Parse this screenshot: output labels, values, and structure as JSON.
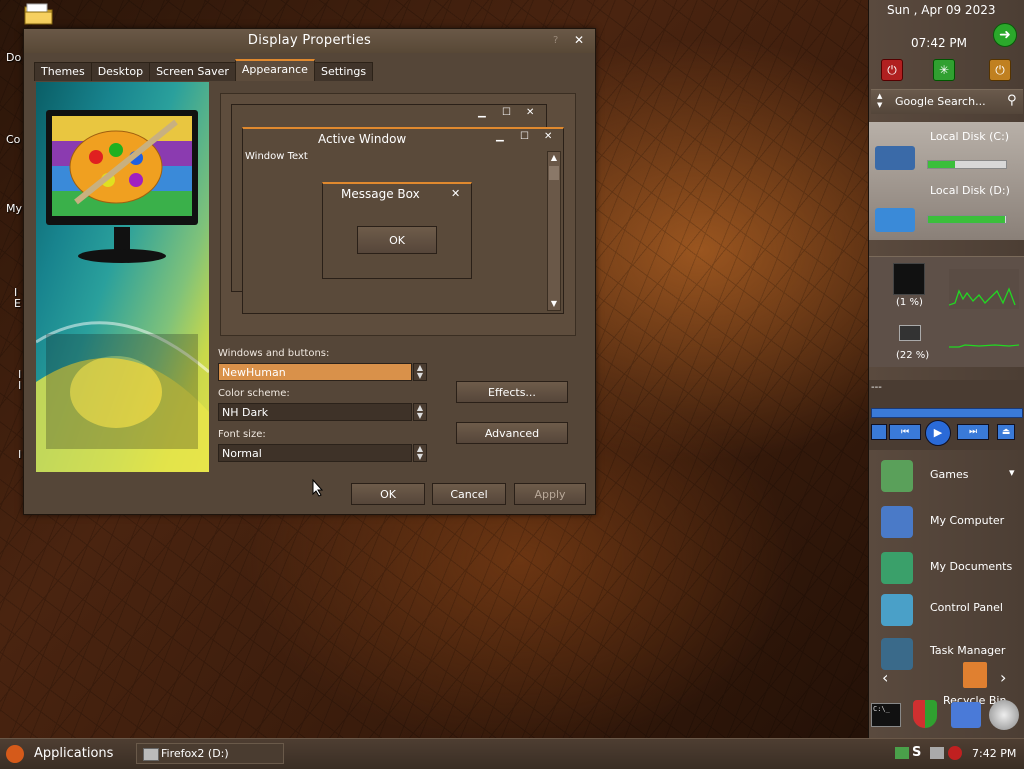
{
  "desktop": {
    "icon_labels": [
      "Do",
      "Co",
      "My",
      "I",
      "E",
      "I",
      "I",
      "I"
    ]
  },
  "dialog": {
    "title": "Display Properties",
    "help_label": "?",
    "close_label": "✕",
    "tabs": [
      {
        "label": "Themes"
      },
      {
        "label": "Desktop"
      },
      {
        "label": "Screen Saver"
      },
      {
        "label": "Appearance"
      },
      {
        "label": "Settings"
      }
    ],
    "active_tab": "Appearance",
    "preview": {
      "inactive_window_controls": [
        "▁",
        "☐",
        "✕"
      ],
      "active_window_title": "Active Window",
      "window_text": "Window Text",
      "message_box_title": "Message Box",
      "message_box_ok": "OK"
    },
    "windows_and_buttons": {
      "label": "Windows and buttons:",
      "value": "NewHuman"
    },
    "color_scheme": {
      "label": "Color scheme:",
      "value": "NH Dark"
    },
    "font_size": {
      "label": "Font size:",
      "value": "Normal"
    },
    "effects_label": "Effects...",
    "advanced_label": "Advanced",
    "ok_label": "OK",
    "cancel_label": "Cancel",
    "apply_label": "Apply"
  },
  "sidebar": {
    "date": "Sun , Apr 09 2023",
    "time": "07:42 PM",
    "search_placeholder": "Google Search...",
    "disk_c": {
      "label": "Local Disk (C:)",
      "used_fraction": 0.35
    },
    "disk_d": {
      "label": "Local Disk (D:)",
      "used_fraction": 0.99
    },
    "cpu_percent": "(1 %)",
    "mem_percent": "(22 %)",
    "media_title": "---",
    "menu": [
      {
        "label": "Games"
      },
      {
        "label": "My Computer"
      },
      {
        "label": "My Documents"
      },
      {
        "label": "Control Panel"
      },
      {
        "label": "Task Manager"
      },
      {
        "label": "Recycle Bin"
      }
    ],
    "prev_arrow": "‹",
    "next_arrow": "›",
    "games_arrow": "▾"
  },
  "taskbar": {
    "applications_label": "Applications",
    "task_label": "Firefox2 (D:)",
    "clock": "7:42 PM"
  },
  "colors": {
    "accent": "#e0892e",
    "selected_field": "#d9914a",
    "progress_green": "#3bbf3b"
  }
}
